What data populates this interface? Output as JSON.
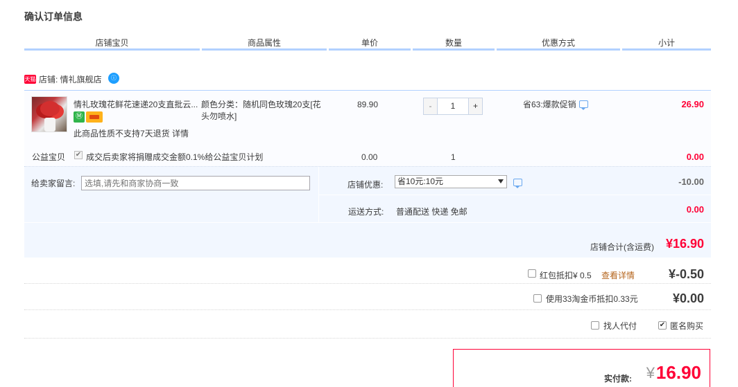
{
  "page": {
    "title": "确认订单信息"
  },
  "table_header": {
    "columns": [
      "店铺宝贝",
      "商品属性",
      "单价",
      "数量",
      "优惠方式",
      "小计"
    ]
  },
  "shop": {
    "logo_text": "天猫",
    "label": "店铺: 情礼旗舰店",
    "ww_icon_text": "ⓘ"
  },
  "item": {
    "name": "情礼玫瑰花鲜花速递20支直批云...",
    "badge_green": "Ⓜ",
    "note": "此商品性质不支持7天退货 详情",
    "attr": "颜色分类：随机同色玫瑰20支[花头勿喷水]",
    "price": "89.90",
    "qty_minus": "-",
    "qty_value": "1",
    "qty_plus": "+",
    "promo": "省63:爆款促销",
    "subtotal": "26.90"
  },
  "charity": {
    "label": "公益宝贝",
    "check": "✔",
    "desc": "成交后卖家将捐赠成交金额0.1%给公益宝贝计划",
    "price": "0.00",
    "qty": "1",
    "total": "0.00"
  },
  "message": {
    "label": "给卖家留言:",
    "placeholder": "选填,请先和商家协商一致"
  },
  "discount": {
    "label": "店铺优惠:",
    "selected": "省10元:10元",
    "value": "-10.00"
  },
  "shipping": {
    "label": "运送方式:",
    "method": "普通配送 快递 免邮",
    "value": "0.00"
  },
  "shop_total": {
    "label": "店铺合计(含运费)",
    "value": "¥16.90"
  },
  "options": {
    "red_packet": {
      "label": "红包抵扣¥ 0.5",
      "link": "查看详情",
      "amount": "¥-0.50"
    },
    "coins": {
      "label": "使用33淘金币抵扣0.33元",
      "amount": "¥0.00"
    },
    "pay_for_me": {
      "label": "找人代付"
    },
    "anonymous": {
      "label": "匿名购买",
      "check": "✔"
    }
  },
  "pay": {
    "label": "实付款:",
    "yen": "¥",
    "value": "16.90"
  }
}
